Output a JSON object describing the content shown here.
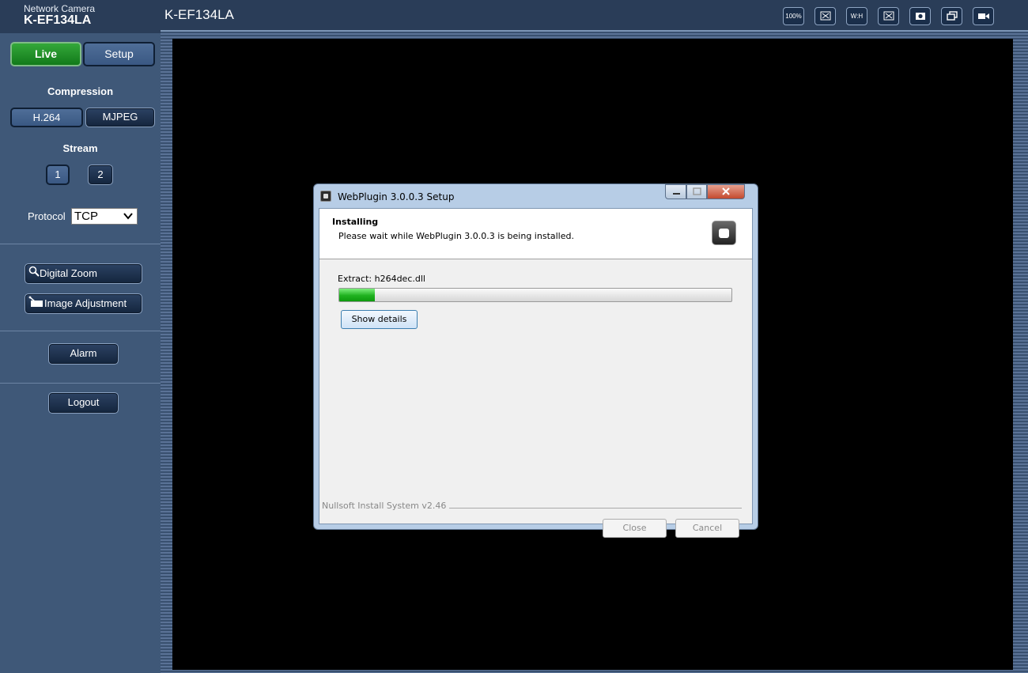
{
  "brand": {
    "subtitle": "Network Camera",
    "model": "K-EF134LA"
  },
  "header": {
    "title": "K-EF134LA",
    "toolbar": [
      {
        "name": "zoom-100-button",
        "label": "100%"
      },
      {
        "name": "fit-window-icon",
        "label": ""
      },
      {
        "name": "aspect-wh-button",
        "label": "W:H"
      },
      {
        "name": "scale-icon",
        "label": ""
      },
      {
        "name": "snapshot-icon",
        "label": ""
      },
      {
        "name": "multiscreen-icon",
        "label": ""
      },
      {
        "name": "record-icon",
        "label": ""
      }
    ]
  },
  "sidebar": {
    "live": "Live",
    "setup": "Setup",
    "compression_label": "Compression",
    "h264": "H.264",
    "mjpeg": "MJPEG",
    "stream_label": "Stream",
    "stream1": "1",
    "stream2": "2",
    "protocol_label": "Protocol",
    "protocol_value": "TCP",
    "digital_zoom": "Digital Zoom",
    "image_adjustment": "Image Adjustment",
    "alarm": "Alarm",
    "logout": "Logout"
  },
  "dialog": {
    "title": "WebPlugin 3.0.0.3 Setup",
    "heading": "Installing",
    "subheading": "Please wait while WebPlugin 3.0.0.3 is being installed.",
    "extract": "Extract: h264dec.dll",
    "progress": 0.09,
    "show_details": "Show details",
    "footer": "Nullsoft Install System v2.46",
    "close": "Close",
    "cancel": "Cancel"
  },
  "colors": {
    "sidebar": "#3f5878",
    "header": "#2a3d58",
    "live_active": "#1f8f27",
    "progress": "#1fb11f"
  }
}
